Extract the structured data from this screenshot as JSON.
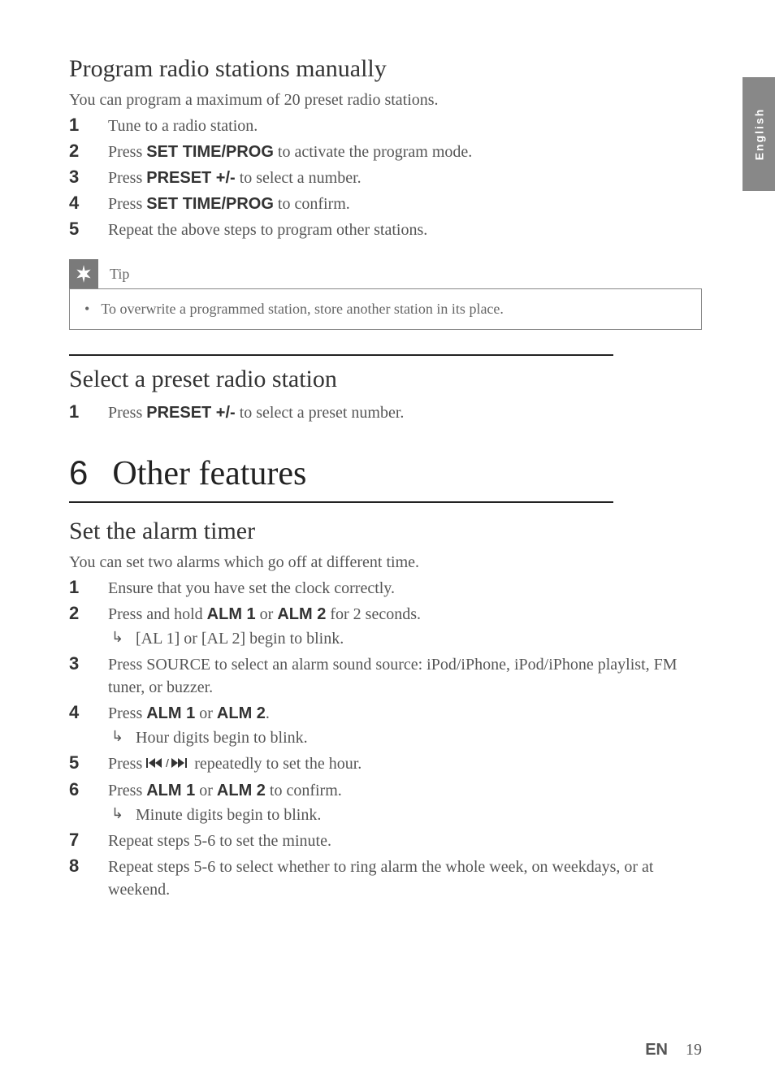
{
  "side_tab": "English",
  "section1": {
    "title": "Program radio stations manually",
    "intro": "You can program a maximum of 20 preset radio stations.",
    "steps": [
      {
        "num": "1",
        "text": "Tune to a radio station."
      },
      {
        "num": "2",
        "pre": "Press ",
        "bold": "SET TIME/PROG",
        "post": " to activate the program mode."
      },
      {
        "num": "3",
        "pre": "Press ",
        "bold": "PRESET +/-",
        "post": " to select a number."
      },
      {
        "num": "4",
        "pre": "Press ",
        "bold": "SET TIME/PROG",
        "post": " to confirm."
      },
      {
        "num": "5",
        "text": "Repeat the above steps to program other stations."
      }
    ]
  },
  "tip": {
    "label": "Tip",
    "text": "To overwrite a programmed station, store another station in its place."
  },
  "section2": {
    "title": "Select a preset radio station",
    "steps": [
      {
        "num": "1",
        "pre": "Press ",
        "bold": "PRESET +/-",
        "post": " to select a preset number."
      }
    ]
  },
  "chapter": {
    "num": "6",
    "title": "Other features"
  },
  "section3": {
    "title": "Set the alarm timer",
    "intro": "You can set two alarms which go off at different time.",
    "steps": [
      {
        "num": "1",
        "text": "Ensure that you have set the clock correctly."
      },
      {
        "num": "2",
        "pre": "Press and hold ",
        "bold": "ALM 1",
        "mid": " or ",
        "bold2": "ALM 2",
        "post": " for 2 seconds.",
        "sub": "[AL 1] or [AL 2] begin to blink."
      },
      {
        "num": "3",
        "text": "Press SOURCE to select an alarm sound source: iPod/iPhone, iPod/iPhone playlist, FM tuner, or buzzer."
      },
      {
        "num": "4",
        "pre": "Press ",
        "bold": "ALM 1",
        "mid": " or ",
        "bold2": "ALM 2",
        "post": ".",
        "sub": "Hour digits begin to blink."
      },
      {
        "num": "5",
        "pre": "Press ",
        "icon": true,
        "post": " repeatedly to set the hour."
      },
      {
        "num": "6",
        "pre": "Press ",
        "bold": "ALM 1",
        "mid": " or ",
        "bold2": "ALM 2",
        "post": " to confirm.",
        "sub": " Minute digits begin to blink."
      },
      {
        "num": "7",
        "text": "Repeat steps 5-6 to set the minute."
      },
      {
        "num": "8",
        "text": "Repeat steps 5-6 to select whether to ring alarm the whole week, on weekdays, or at weekend."
      }
    ]
  },
  "footer": {
    "lang": "EN",
    "page": "19"
  }
}
